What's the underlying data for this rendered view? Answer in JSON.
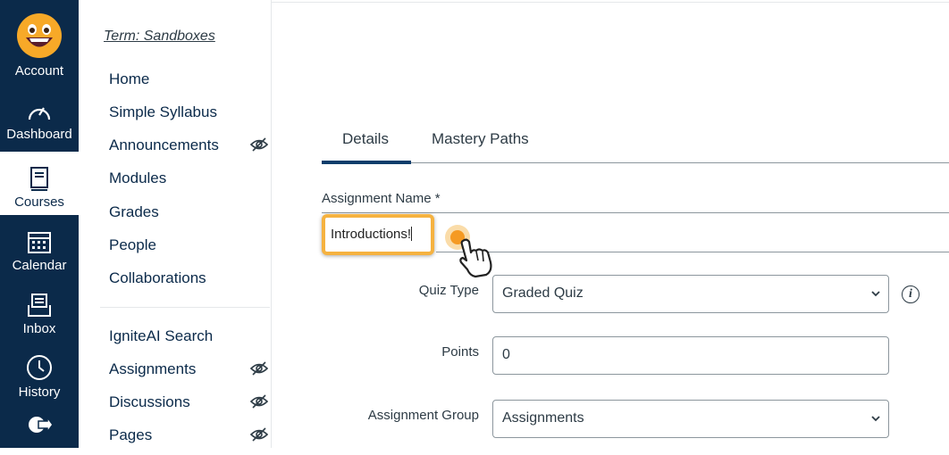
{
  "global_nav": {
    "account": "Account",
    "dashboard": "Dashboard",
    "courses": "Courses",
    "calendar": "Calendar",
    "inbox": "Inbox",
    "history": "History",
    "commons": "Commons"
  },
  "course_nav": {
    "term": "Term: Sandboxes",
    "items": [
      {
        "label": "Home"
      },
      {
        "label": "Simple Syllabus"
      },
      {
        "label": "Announcements",
        "hidden": true
      },
      {
        "label": "Modules"
      },
      {
        "label": "Grades"
      },
      {
        "label": "People"
      },
      {
        "label": "Collaborations"
      },
      {
        "label": "IgniteAI Search"
      },
      {
        "label": "Assignments",
        "hidden": true
      },
      {
        "label": "Discussions",
        "hidden": true
      },
      {
        "label": "Pages",
        "hidden": true
      }
    ]
  },
  "tabs": [
    {
      "label": "Details",
      "active": true
    },
    {
      "label": "Mastery Paths",
      "active": false
    }
  ],
  "form": {
    "assignment_name_label": "Assignment Name *",
    "assignment_name_value": "Introductions!",
    "quiz_type_label": "Quiz Type",
    "quiz_type_value": "Graded Quiz",
    "points_label": "Points",
    "points_value": "0",
    "assignment_group_label": "Assignment Group",
    "assignment_group_value": "Assignments"
  },
  "colors": {
    "nav_bg": "#0b2a4a",
    "highlight": "#f5b240",
    "tab_active": "#0b3d6b"
  }
}
